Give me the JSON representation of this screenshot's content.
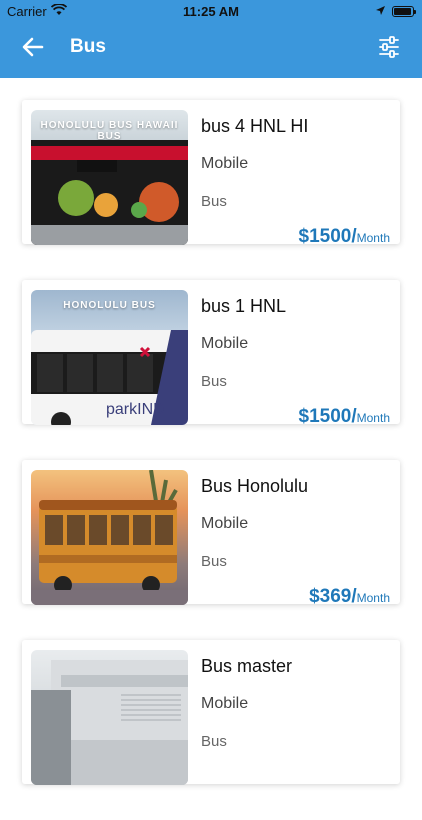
{
  "status_bar": {
    "carrier": "Carrier",
    "time": "11:25 AM",
    "battery_level": 0.95
  },
  "header": {
    "title": "Bus"
  },
  "listings": [
    {
      "title": "bus 4 HNL HI",
      "subtitle": "Mobile",
      "category": "Bus",
      "price": "$1500/",
      "unit": "Month",
      "image_caption": "HONOLULU BUS HAWAII BUS"
    },
    {
      "title": "bus 1 HNL",
      "subtitle": "Mobile",
      "category": "Bus",
      "price": "$1500/",
      "unit": "Month",
      "image_caption": "HONOLULU BUS"
    },
    {
      "title": "Bus Honolulu",
      "subtitle": "Mobile",
      "category": "Bus",
      "price": "$369/",
      "unit": "Month"
    },
    {
      "title": "Bus master",
      "subtitle": "Mobile",
      "category": "Bus"
    }
  ],
  "colors": {
    "accent": "#3b97dc",
    "price": "#1f78b9"
  }
}
